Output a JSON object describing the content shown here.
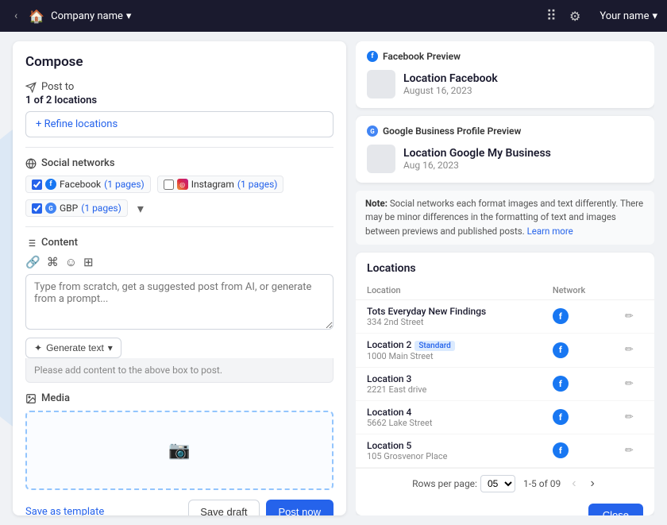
{
  "nav": {
    "back_icon": "‹",
    "home_icon": "⌂",
    "company_label": "Company name",
    "dropdown_icon": "▾",
    "grid_icon": "⠿",
    "gear_icon": "⚙",
    "user_label": "Your name",
    "user_dropdown": "▾"
  },
  "compose": {
    "title": "Compose",
    "post_to_label": "Post to",
    "locations_count": "1 of 2 locations",
    "refine_link": "+ Refine locations",
    "social_networks_label": "Social networks",
    "networks": [
      {
        "id": "facebook",
        "label": "Facebook",
        "pages": "(1 pages)",
        "checked": true
      },
      {
        "id": "instagram",
        "label": "Instagram",
        "pages": "(1 pages)",
        "checked": false
      },
      {
        "id": "gbp",
        "label": "GBP",
        "pages": "(1 pages)",
        "checked": true
      }
    ],
    "content_label": "Content",
    "content_placeholder": "Type from scratch, get a suggested post from AI, or generate from a prompt...",
    "generate_btn": "Generate text",
    "add_content_notice": "Please add content to the above box to post.",
    "media_label": "Media",
    "save_template": "Save as template",
    "save_draft": "Save draft",
    "post_now": "Post now"
  },
  "facebook_preview": {
    "header": "Facebook Preview",
    "location_name": "Location Facebook",
    "date": "August 16, 2023"
  },
  "gbp_preview": {
    "header": "Google Business Profile Preview",
    "location_name": "Location Google My Business",
    "date": "Aug 16, 2023"
  },
  "note": {
    "label": "Note:",
    "text": " Social networks each format images and text differently. There may be minor differences in the formatting of text and images between previews and published posts.",
    "link": "Learn more"
  },
  "locations_table": {
    "title": "Locations",
    "col_location": "Location",
    "col_network": "Network",
    "rows": [
      {
        "name": "Tots Everyday New Findings",
        "address": "334 2nd Street",
        "badge": null,
        "network": "fb"
      },
      {
        "name": "Location 2",
        "address": "1000 Main Street",
        "badge": "Standard",
        "network": "fb"
      },
      {
        "name": "Location 3",
        "address": "2221 East drive",
        "badge": null,
        "network": "fb"
      },
      {
        "name": "Location 4",
        "address": "5662 Lake Street",
        "badge": null,
        "network": "fb"
      },
      {
        "name": "Location 5",
        "address": "105 Grosvenor Place",
        "badge": null,
        "network": "fb"
      }
    ],
    "rows_per_page_label": "Rows per page:",
    "rows_per_page_value": "05",
    "pagination": "1-5 of 09",
    "close_btn": "Close"
  }
}
